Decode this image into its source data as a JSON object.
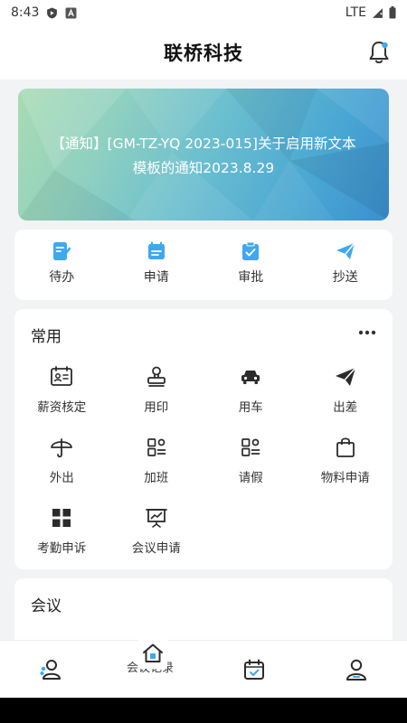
{
  "status_bar": {
    "time": "8:43",
    "network": "LTE"
  },
  "header": {
    "title": "联桥科技",
    "bell_icon": "bell-icon"
  },
  "banner": {
    "text": "【通知】[GM-TZ-YQ 2023-015]关于启用新文本模板的通知2023.8.29"
  },
  "quick_actions": [
    {
      "label": "待办",
      "icon": "todo-icon"
    },
    {
      "label": "申请",
      "icon": "apply-icon"
    },
    {
      "label": "审批",
      "icon": "approve-icon"
    },
    {
      "label": "抄送",
      "icon": "send-icon"
    }
  ],
  "common": {
    "title": "常用",
    "items": [
      {
        "label": "薪资核定",
        "icon": "id-card-icon"
      },
      {
        "label": "用印",
        "icon": "stamp-icon"
      },
      {
        "label": "用车",
        "icon": "car-icon"
      },
      {
        "label": "出差",
        "icon": "paper-plane-icon"
      },
      {
        "label": "外出",
        "icon": "umbrella-icon"
      },
      {
        "label": "加班",
        "icon": "overtime-icon"
      },
      {
        "label": "请假",
        "icon": "leave-icon"
      },
      {
        "label": "物料申请",
        "icon": "bag-icon"
      },
      {
        "label": "考勤申诉",
        "icon": "grid-icon"
      },
      {
        "label": "会议申请",
        "icon": "presentation-icon"
      }
    ]
  },
  "meeting": {
    "title": "会议",
    "peek_label": "会议记录"
  },
  "colors": {
    "accent": "#3ea8f0",
    "icon_dark": "#2b2b2b",
    "background": "#f2f3f5"
  },
  "bottom_nav": [
    {
      "icon": "contacts-icon"
    },
    {
      "icon": "home-icon"
    },
    {
      "icon": "calendar-icon"
    },
    {
      "icon": "profile-icon"
    }
  ]
}
